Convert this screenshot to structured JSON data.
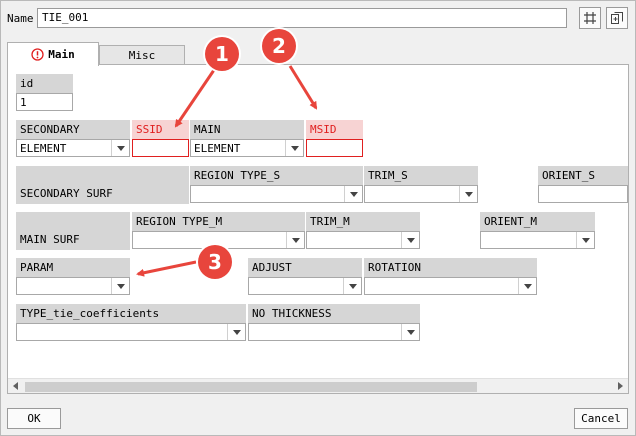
{
  "header": {
    "name_label": "Name",
    "name_value": "TIE_001"
  },
  "tabs": [
    {
      "label": "Main",
      "warning_icon": "!"
    },
    {
      "label": "Misc"
    }
  ],
  "fields": {
    "id": {
      "label": "id",
      "value": "1"
    },
    "secondary": {
      "label": "SECONDARY",
      "value": "ELEMENT"
    },
    "ssid": {
      "label": "SSID",
      "value": ""
    },
    "main": {
      "label": "MAIN",
      "value": "ELEMENT"
    },
    "msid": {
      "label": "MSID",
      "value": ""
    },
    "secondary_surf": {
      "label": "SECONDARY SURF"
    },
    "region_type_s": {
      "label": "REGION TYPE_S",
      "value": ""
    },
    "trim_s": {
      "label": "TRIM_S",
      "value": ""
    },
    "orient_s": {
      "label": "ORIENT_S",
      "value": ""
    },
    "main_surf": {
      "label": "MAIN SURF"
    },
    "region_type_m": {
      "label": "REGION TYPE_M",
      "value": ""
    },
    "trim_m": {
      "label": "TRIM_M",
      "value": ""
    },
    "orient_m": {
      "label": "ORIENT_M",
      "value": ""
    },
    "param": {
      "label": "PARAM",
      "value": ""
    },
    "adjust": {
      "label": "ADJUST",
      "value": ""
    },
    "rotation": {
      "label": "ROTATION",
      "value": ""
    },
    "type_tie": {
      "label": "TYPE_tie_coefficients",
      "value": ""
    },
    "no_thickness": {
      "label": "NO THICKNESS",
      "value": ""
    }
  },
  "annotations": [
    "1",
    "2",
    "3"
  ],
  "footer": {
    "ok_label": "OK",
    "cancel_label": "Cancel"
  },
  "colors": {
    "required_text": "#e02020",
    "required_header_bg": "#f7d3d3",
    "badge": "#e8453c",
    "header_bg": "#d6d6d6"
  },
  "icons": {
    "toolbar_1": "pick-icon",
    "toolbar_2": "copy-icon",
    "tab_warning": "warning-icon"
  }
}
